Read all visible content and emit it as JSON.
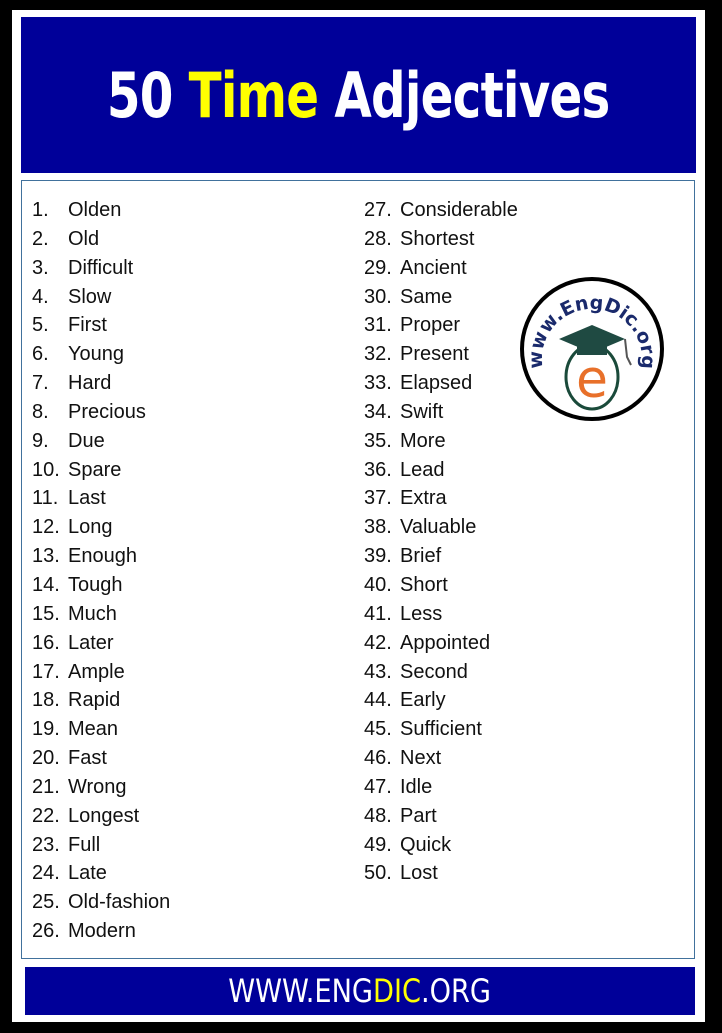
{
  "header": {
    "title_prefix": "50",
    "title_highlight": "Time",
    "title_suffix": "Adjectives"
  },
  "colors": {
    "navy": "#000099",
    "highlight": "#ffff00",
    "frame": "#000000",
    "box_border": "#41719c"
  },
  "list": {
    "left": [
      {
        "num": "1.",
        "word": "Olden"
      },
      {
        "num": "2.",
        "word": "Old"
      },
      {
        "num": "3.",
        "word": "Difficult"
      },
      {
        "num": "4.",
        "word": "Slow"
      },
      {
        "num": "5.",
        "word": "First"
      },
      {
        "num": "6.",
        "word": "Young"
      },
      {
        "num": "7.",
        "word": "Hard"
      },
      {
        "num": "8.",
        "word": "Precious"
      },
      {
        "num": "9.",
        "word": "Due"
      },
      {
        "num": "10.",
        "word": "Spare"
      },
      {
        "num": "11.",
        "word": "Last"
      },
      {
        "num": "12.",
        "word": "Long"
      },
      {
        "num": "13.",
        "word": "Enough"
      },
      {
        "num": "14.",
        "word": "Tough"
      },
      {
        "num": "15.",
        "word": "Much"
      },
      {
        "num": "16.",
        "word": "Later"
      },
      {
        "num": "17.",
        "word": "Ample"
      },
      {
        "num": "18.",
        "word": "Rapid"
      },
      {
        "num": "19.",
        "word": "Mean"
      },
      {
        "num": "20.",
        "word": "Fast"
      },
      {
        "num": "21.",
        "word": "Wrong"
      },
      {
        "num": "22.",
        "word": "Longest"
      },
      {
        "num": "23.",
        "word": "Full"
      },
      {
        "num": "24.",
        "word": "Late"
      },
      {
        "num": "25.",
        "word": "Old-fashion"
      },
      {
        "num": "26.",
        "word": "Modern"
      }
    ],
    "right": [
      {
        "num": "27.",
        "word": "Considerable"
      },
      {
        "num": "28.",
        "word": "Shortest"
      },
      {
        "num": "29.",
        "word": "Ancient"
      },
      {
        "num": "30.",
        "word": "Same"
      },
      {
        "num": "31.",
        "word": "Proper"
      },
      {
        "num": "32.",
        "word": "Present"
      },
      {
        "num": "33.",
        "word": "Elapsed"
      },
      {
        "num": "34.",
        "word": "Swift"
      },
      {
        "num": "35.",
        "word": "More"
      },
      {
        "num": "36.",
        "word": "Lead"
      },
      {
        "num": "37.",
        "word": "Extra"
      },
      {
        "num": "38.",
        "word": "Valuable"
      },
      {
        "num": "39.",
        "word": "Brief"
      },
      {
        "num": "40.",
        "word": "Short"
      },
      {
        "num": "41.",
        "word": "Less"
      },
      {
        "num": "42.",
        "word": "Appointed"
      },
      {
        "num": "43.",
        "word": "Second"
      },
      {
        "num": "44.",
        "word": "Early"
      },
      {
        "num": "45.",
        "word": "Sufficient"
      },
      {
        "num": "46.",
        "word": "Next"
      },
      {
        "num": "47.",
        "word": "Idle"
      },
      {
        "num": "48.",
        "word": "Part"
      },
      {
        "num": "49.",
        "word": "Quick"
      },
      {
        "num": "50.",
        "word": "Lost"
      }
    ]
  },
  "logo": {
    "icon": "engdic-logo-icon",
    "text": "www.EngDic.org",
    "letter": "e"
  },
  "footer": {
    "prefix": "WWW.ENG",
    "highlight": "DIC",
    "suffix": ".ORG"
  }
}
